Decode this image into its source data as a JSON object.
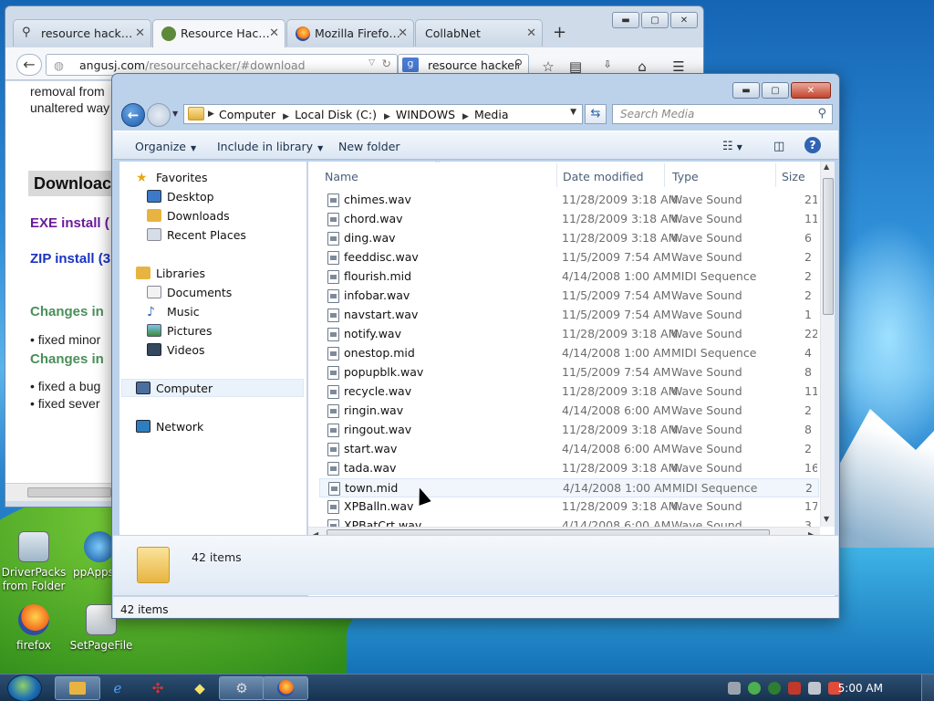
{
  "browser": {
    "tabs": [
      {
        "label": "resource hack…",
        "icon": "search-icon"
      },
      {
        "label": "Resource Hac…",
        "icon": "aj-favicon"
      },
      {
        "label": "Mozilla Firefo…",
        "icon": "firefox-icon"
      },
      {
        "label": "CollabNet",
        "icon": ""
      }
    ],
    "new_tab": "+",
    "url_domain": "angusj.com",
    "url_path": "/resourcehacker/#download",
    "search_text": "resource hacker",
    "page_text": {
      "line1": "removal from",
      "line2": "unaltered way",
      "download": "Downloac",
      "exe": "EXE install (",
      "zip": "ZIP install (3",
      "changes1": "Changes in",
      "fixed1": "• fixed minor",
      "changes2": "Changes in",
      "fixed2": "• fixed a bug",
      "fixed3": "• fixed sever"
    }
  },
  "explorer": {
    "breadcrumb": [
      "Computer",
      "Local Disk (C:)",
      "WINDOWS",
      "Media"
    ],
    "search_placeholder": "Search Media",
    "toolbar": {
      "organize": "Organize",
      "include": "Include in library",
      "new_folder": "New folder"
    },
    "nav": {
      "favorites": "Favorites",
      "desktop": "Desktop",
      "downloads": "Downloads",
      "recent": "Recent Places",
      "libraries": "Libraries",
      "documents": "Documents",
      "music": "Music",
      "pictures": "Pictures",
      "videos": "Videos",
      "computer": "Computer",
      "network": "Network"
    },
    "columns": {
      "name": "Name",
      "date": "Date modified",
      "type": "Type",
      "size": "Size"
    },
    "files": [
      {
        "name": "chimes.wav",
        "date": "11/28/2009 3:18 AM",
        "type": "Wave Sound",
        "size": "21"
      },
      {
        "name": "chord.wav",
        "date": "11/28/2009 3:18 AM",
        "type": "Wave Sound",
        "size": "11"
      },
      {
        "name": "ding.wav",
        "date": "11/28/2009 3:18 AM",
        "type": "Wave Sound",
        "size": "6"
      },
      {
        "name": "feeddisc.wav",
        "date": "11/5/2009 7:54 AM",
        "type": "Wave Sound",
        "size": "2"
      },
      {
        "name": "flourish.mid",
        "date": "4/14/2008 1:00 AM",
        "type": "MIDI Sequence",
        "size": "2"
      },
      {
        "name": "infobar.wav",
        "date": "11/5/2009 7:54 AM",
        "type": "Wave Sound",
        "size": "2"
      },
      {
        "name": "navstart.wav",
        "date": "11/5/2009 7:54 AM",
        "type": "Wave Sound",
        "size": "1"
      },
      {
        "name": "notify.wav",
        "date": "11/28/2009 3:18 AM",
        "type": "Wave Sound",
        "size": "22"
      },
      {
        "name": "onestop.mid",
        "date": "4/14/2008 1:00 AM",
        "type": "MIDI Sequence",
        "size": "4"
      },
      {
        "name": "popupblk.wav",
        "date": "11/5/2009 7:54 AM",
        "type": "Wave Sound",
        "size": "8"
      },
      {
        "name": "recycle.wav",
        "date": "11/28/2009 3:18 AM",
        "type": "Wave Sound",
        "size": "11"
      },
      {
        "name": "ringin.wav",
        "date": "4/14/2008 6:00 AM",
        "type": "Wave Sound",
        "size": "2"
      },
      {
        "name": "ringout.wav",
        "date": "11/28/2009 3:18 AM",
        "type": "Wave Sound",
        "size": "8"
      },
      {
        "name": "start.wav",
        "date": "4/14/2008 6:00 AM",
        "type": "Wave Sound",
        "size": "2"
      },
      {
        "name": "tada.wav",
        "date": "11/28/2009 3:18 AM",
        "type": "Wave Sound",
        "size": "16"
      },
      {
        "name": "town.mid",
        "date": "4/14/2008 1:00 AM",
        "type": "MIDI Sequence",
        "size": "2"
      },
      {
        "name": "XPBalln.wav",
        "date": "11/28/2009 3:18 AM",
        "type": "Wave Sound",
        "size": "17"
      },
      {
        "name": "XPBatCrt.wav",
        "date": "4/14/2008 6:00 AM",
        "type": "Wave Sound",
        "size": "3"
      }
    ],
    "details_count": "42 items",
    "status_count": "42 items"
  },
  "desktop_icons": [
    {
      "label": "DriverPacks from Folder"
    },
    {
      "label": "ppAppsv"
    },
    {
      "label": "firefox"
    },
    {
      "label": "SetPageFile"
    }
  ],
  "taskbar": {
    "clock": "5:00 AM"
  },
  "colors": {
    "accent": "#1c6fb8",
    "link_purple": "#6a1b9a",
    "link_blue": "#1a33c2",
    "heading_green": "#4a8f5a"
  }
}
